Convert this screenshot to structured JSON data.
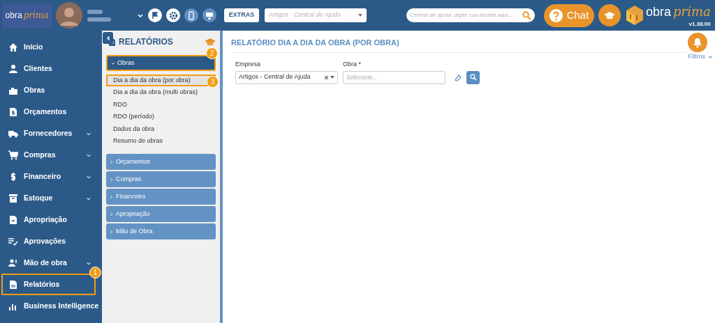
{
  "header": {
    "logo": {
      "word1": "obra",
      "word2": "prima"
    },
    "extras_button": "EXTRAS",
    "site_select": {
      "value": "Artigos - Central de Ajuda"
    },
    "help_search": {
      "placeholder": "Central de ajuda: digite sua dúvida aqui..."
    },
    "chat_button": "Chat",
    "brand": {
      "word1": "obra",
      "word2": "prima",
      "version": "v1.38.00"
    }
  },
  "sidebar": {
    "items": [
      {
        "label": "Início",
        "expandable": false,
        "selected": false
      },
      {
        "label": "Clientes",
        "expandable": false,
        "selected": false
      },
      {
        "label": "Obras",
        "expandable": false,
        "selected": false
      },
      {
        "label": "Orçamentos",
        "expandable": false,
        "selected": false
      },
      {
        "label": "Fornecedores",
        "expandable": true,
        "selected": false
      },
      {
        "label": "Compras",
        "expandable": true,
        "selected": false
      },
      {
        "label": "Financeiro",
        "expandable": true,
        "selected": false
      },
      {
        "label": "Estoque",
        "expandable": true,
        "selected": false
      },
      {
        "label": "Apropriação",
        "expandable": false,
        "selected": false
      },
      {
        "label": "Aprovações",
        "expandable": false,
        "selected": false
      },
      {
        "label": "Mão de obra",
        "expandable": true,
        "selected": false
      },
      {
        "label": "Relatórios",
        "expandable": false,
        "selected": true,
        "annotation": "1"
      },
      {
        "label": "Business Intelligence",
        "expandable": false,
        "selected": false
      }
    ]
  },
  "submenu": {
    "title": "RELATÓRIOS",
    "groups": [
      {
        "label": "Obras",
        "expanded": true,
        "annotation": "2",
        "items": [
          {
            "label": "Dia a dia da obra (por obra)",
            "selected": true,
            "annotation": "3"
          },
          {
            "label": "Dia a dia da obra (multi obras)",
            "selected": false
          },
          {
            "label": "RDO",
            "selected": false
          },
          {
            "label": "RDO (período)",
            "selected": false
          },
          {
            "label": "Dados da obra",
            "selected": false
          },
          {
            "label": "Resumo de obras",
            "selected": false
          }
        ]
      },
      {
        "label": "Orçamentos",
        "expanded": false
      },
      {
        "label": "Compras",
        "expanded": false
      },
      {
        "label": "Financeiro",
        "expanded": false
      },
      {
        "label": "Apropriação",
        "expanded": false
      },
      {
        "label": "Mão de Obra",
        "expanded": false
      }
    ]
  },
  "main": {
    "title": "RELATÓRIO DIA A DIA DA OBRA (POR OBRA)",
    "filters_link": "Filtros",
    "fields": [
      {
        "kind": "select",
        "label": "Empresa",
        "value": "Artigos - Central de Ajuda"
      },
      {
        "kind": "input",
        "label": "Obra *",
        "placeholder": "Selecione..."
      }
    ]
  }
}
